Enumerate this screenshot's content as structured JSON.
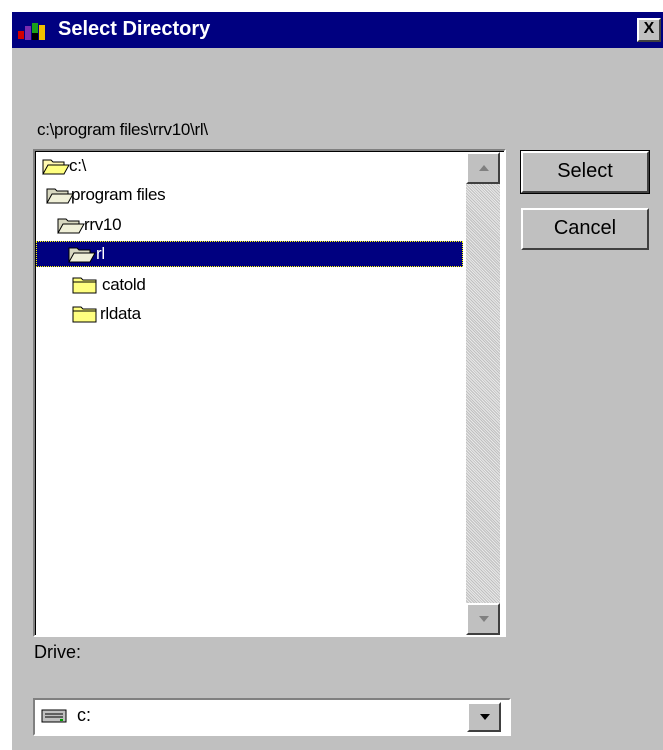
{
  "window": {
    "title": "Select Directory",
    "close_glyph": "X"
  },
  "current_path": "c:\\program files\\rrv10\\rl\\",
  "tree": {
    "items": [
      {
        "label": "c:\\",
        "icon": "open-folder-icon",
        "depth": 0,
        "selected": false
      },
      {
        "label": "program files",
        "icon": "open-folder-icon",
        "depth": 1,
        "selected": false
      },
      {
        "label": "rrv10",
        "icon": "open-folder-icon",
        "depth": 2,
        "selected": false
      },
      {
        "label": "rl",
        "icon": "open-folder-icon",
        "depth": 3,
        "selected": true
      },
      {
        "label": "catold",
        "icon": "closed-folder-icon",
        "depth": 4,
        "selected": false
      },
      {
        "label": "rldata",
        "icon": "closed-folder-icon",
        "depth": 4,
        "selected": false
      }
    ]
  },
  "buttons": {
    "select_label": "Select",
    "cancel_label": "Cancel"
  },
  "drive": {
    "label": "Drive:",
    "value": "c:",
    "icon": "hard-drive-icon"
  },
  "colors": {
    "titlebar": "#000080",
    "dialog_face": "#c0c0c0",
    "selection": "#000080"
  }
}
